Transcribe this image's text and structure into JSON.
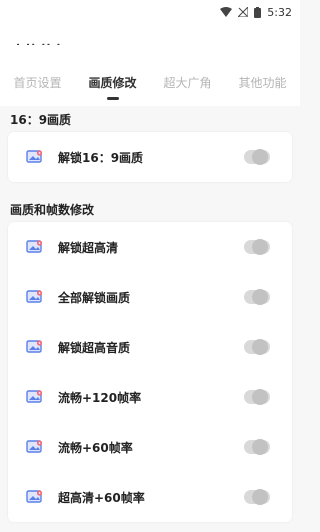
{
  "status_bar": {
    "time": "5:32"
  },
  "app": {
    "title": "· ·· ·· ·"
  },
  "tabs": [
    {
      "label": "首页设置",
      "active": false
    },
    {
      "label": "画质修改",
      "active": true
    },
    {
      "label": "超大广角",
      "active": false
    },
    {
      "label": "其他功能",
      "active": false
    }
  ],
  "section1": {
    "title": "16：9画质",
    "items": [
      {
        "label": "解锁16：9画质",
        "enabled": false
      }
    ]
  },
  "section2": {
    "title": "画质和帧数修改",
    "items": [
      {
        "label": "解锁超高清",
        "enabled": false
      },
      {
        "label": "全部解锁画质",
        "enabled": false
      },
      {
        "label": "解锁超高音质",
        "enabled": false
      },
      {
        "label": "流畅+120帧率",
        "enabled": false
      },
      {
        "label": "流畅+60帧率",
        "enabled": false
      },
      {
        "label": "超高清+60帧率",
        "enabled": false
      }
    ]
  },
  "colors": {
    "icon_blue": "#5b7fe8",
    "icon_pink": "#f06a7c",
    "toggle_off": "#d9d9d9"
  }
}
